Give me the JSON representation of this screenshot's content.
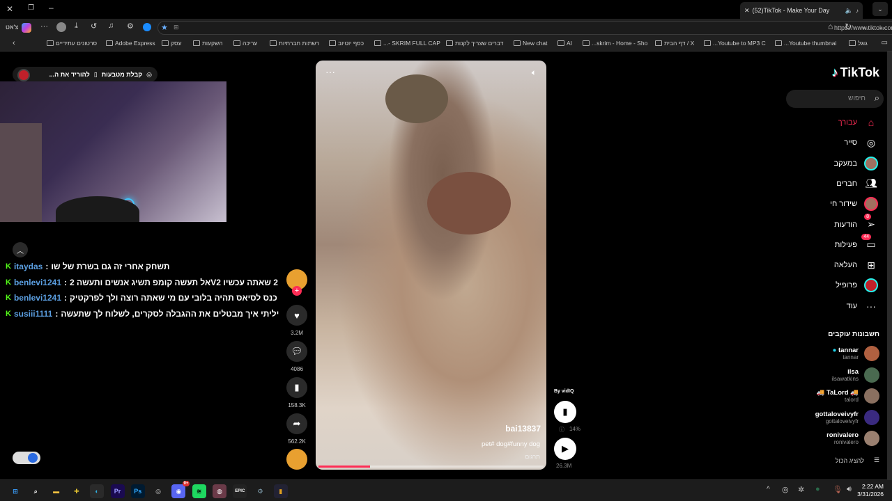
{
  "browser": {
    "tab_title": "(52)TikTok - Make Your Day",
    "url": "https://www.tiktok.com",
    "chat_label": "צ'אט",
    "bookmarks": [
      "גוגל",
      "Youtube thumbnai...",
      "Youtube to MP3 C...",
      "X / דף הבית",
      "skrim - Home - Sho...",
      "AI",
      "New chat",
      "דברים שצריך לקנות",
      "SKRIM FULL CAP -...",
      "כסף יוטיוב",
      "רשתות חברתיות",
      "עריכה",
      "השקעות",
      "עסק",
      "Adobe Express",
      "סרטונים עתידיים"
    ]
  },
  "stream": {
    "coins_label": "קבלת מטבעות",
    "download_label": "להוריד את ה...",
    "chat": [
      {
        "user": "itaydas",
        "message": "תשחק אחרי זה גם בשרת של שו"
      },
      {
        "user": "benlevi1241",
        "message": "2 שאתה עכשיו V2אל תעשה קומפ תשיג אנשים ותעשה 2"
      },
      {
        "user": "benlevi1241",
        "message": "כנס לסיאס תהיה בלובי עם מי שאתה רוצה ולך לפרקטיק"
      },
      {
        "user": "susiii1111",
        "message": "יליתי איך מבטלים את ההגבלה לסקרים, לשלוח לך שתעשה"
      }
    ]
  },
  "video": {
    "author": "bai13837",
    "caption": "pet# dog#funny dog",
    "translate": "תרגום",
    "likes": "3.2M",
    "comments": "4086",
    "saves": "158.3K",
    "shares": "562.2K",
    "progress_percent": 23,
    "vidiq_label": "By vidIQ",
    "vidiq_score": "14%",
    "views": "26.3M"
  },
  "tiktok": {
    "logo": "TikTok",
    "search_placeholder": "חיפוש",
    "nav": [
      {
        "label": "עבורך",
        "icon": "home-icon",
        "active": true
      },
      {
        "label": "סייר",
        "icon": "compass-icon"
      },
      {
        "label": "במעקב",
        "icon": "following-avatar-icon"
      },
      {
        "label": "חברים",
        "icon": "friends-icon"
      },
      {
        "label": "שידור חי",
        "icon": "live-avatar-icon"
      },
      {
        "label": "הודעות",
        "icon": "send-icon",
        "badge": "8"
      },
      {
        "label": "פעילות",
        "icon": "activity-icon",
        "badge": "44"
      },
      {
        "label": "העלאה",
        "icon": "upload-icon"
      },
      {
        "label": "פרופיל",
        "icon": "profile-icon"
      },
      {
        "label": "עוד",
        "icon": "more-icon"
      }
    ],
    "following_title": "חשבונות עוקבים",
    "accounts": [
      {
        "name": "tannar",
        "handle": "tannar",
        "verified": true
      },
      {
        "name": "ilsa",
        "handle": "ilsawatkins"
      },
      {
        "name": "🚚 TaLord 🚚",
        "handle": "talord"
      },
      {
        "name": "gottaloveivyfr",
        "handle": "gottaloveivyfr"
      },
      {
        "name": "ronivalero",
        "handle": "ronivalero"
      }
    ],
    "show_all": "להציג הכול"
  },
  "taskbar": {
    "time": "2:22 AM",
    "date": "3/31/2026",
    "discord_badge": "9+",
    "apps": [
      "start",
      "search",
      "file-explorer",
      "puzzle",
      "edge",
      "premiere",
      "photoshop",
      "obs",
      "discord",
      "spotify",
      "steam",
      "epic",
      "settings",
      "cs"
    ]
  },
  "colors": {
    "accent": "#fe2c55",
    "kick": "#53fc18",
    "chat_user": "#5b9ee0"
  }
}
